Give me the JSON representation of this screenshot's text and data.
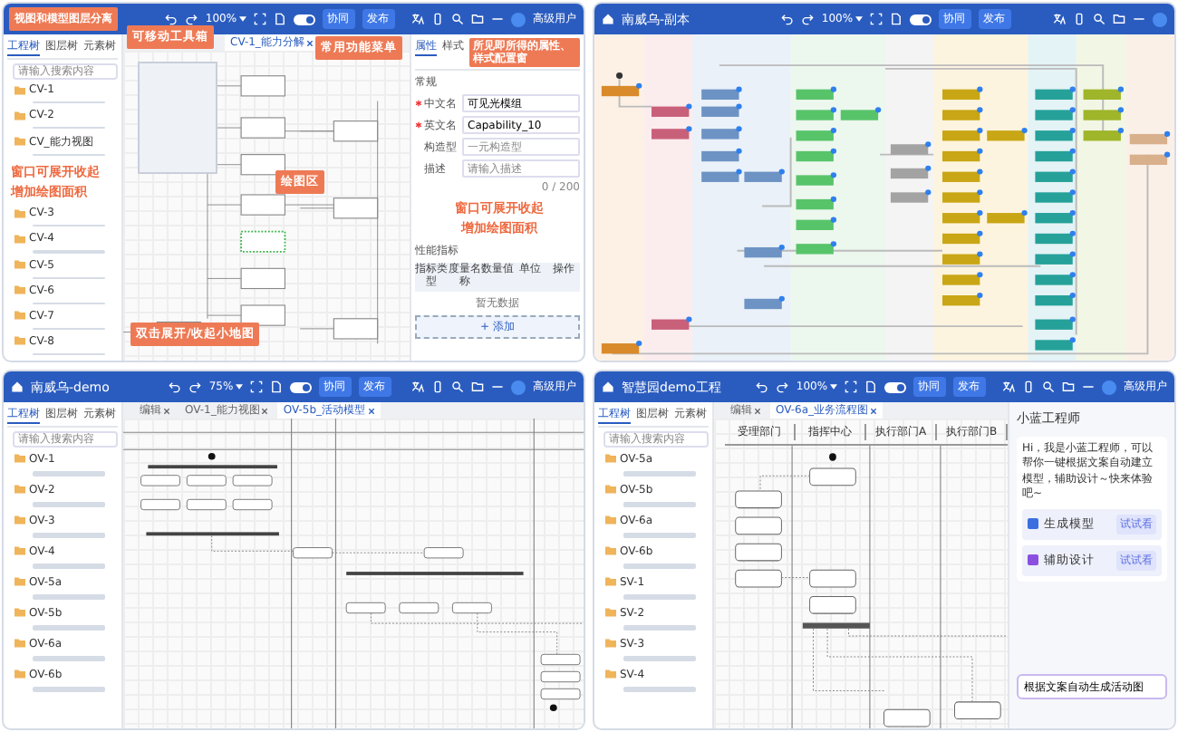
{
  "panels": [
    {
      "zoom": "100%",
      "toggle_on": true,
      "buttons": [
        "协同",
        "发布"
      ],
      "user": "高级用户",
      "sidebar": {
        "tabs": [
          {
            "label": "工程树",
            "selected": true
          },
          {
            "label": "图层树",
            "selected": false
          },
          {
            "label": "元素树",
            "selected": false
          }
        ],
        "placeholder": "请输入搜索内容",
        "tree": [
          {
            "label": "CV-1"
          },
          {
            "label": "CV-2"
          },
          {
            "label": "CV_能力视图"
          },
          {
            "label": "CV-3"
          },
          {
            "label": "CV-4"
          },
          {
            "label": "CV-5"
          },
          {
            "label": "CV-6"
          },
          {
            "label": "CV-7"
          },
          {
            "label": "CV-8"
          }
        ]
      },
      "doc_tabs": [
        {
          "label": "CV-1_能力分解",
          "selected": true
        }
      ],
      "diagram": {
        "kind": "block"
      },
      "properties": {
        "tabs": [
          {
            "label": "属性",
            "selected": true
          },
          {
            "label": "样式",
            "selected": false
          }
        ],
        "section": "常规",
        "fields": [
          {
            "label": "中文名",
            "value": "可见光模组",
            "required": true
          },
          {
            "label": "英文名",
            "value": "Capability_10",
            "required": true
          },
          {
            "label": "构造型",
            "placeholder": "一元构造型",
            "required": false
          },
          {
            "label": "描述",
            "placeholder": "请输入描述",
            "required": false
          }
        ],
        "counter": "0 / 200",
        "table_title": "性能指标",
        "columns": [
          "指标类型",
          "度量名称",
          "数量值",
          "单位",
          "操作"
        ],
        "empty": "暂无数据",
        "add": "+ 添加"
      },
      "callouts": [
        "视图和模型图层分离",
        "可移动工具箱",
        "常用功能菜单",
        "所见即所得的属性、样式配置窗",
        "窗口可展开收起",
        "增加绘图面积",
        "绘图区",
        "窗口可展开收起",
        "增加绘图面积",
        "双击展开/收起小地图"
      ]
    },
    {
      "title": "南威乌-副本",
      "zoom": "100%",
      "toggle_on": true,
      "buttons": [
        "协同",
        "发布"
      ],
      "diagram": {
        "kind": "flow"
      }
    },
    {
      "title": "南威乌-demo",
      "zoom": "75%",
      "toggle_on": true,
      "buttons": [
        "协同",
        "发布"
      ],
      "user": "高级用户",
      "sidebar": {
        "tabs": [
          {
            "label": "工程树",
            "selected": true
          },
          {
            "label": "图层树",
            "selected": false
          },
          {
            "label": "元素树",
            "selected": false
          }
        ],
        "placeholder": "请输入搜索内容",
        "tree": [
          {
            "label": "OV-1"
          },
          {
            "label": "OV-2"
          },
          {
            "label": "OV-3"
          },
          {
            "label": "OV-4"
          },
          {
            "label": "OV-5a"
          },
          {
            "label": "OV-5b"
          },
          {
            "label": "OV-6a"
          },
          {
            "label": "OV-6b"
          }
        ]
      },
      "doc_tabs": [
        {
          "label": "编辑",
          "selected": false
        },
        {
          "label": "OV-1_能力视图",
          "selected": false
        },
        {
          "label": "OV-5b_活动模型",
          "selected": true
        }
      ],
      "diagram": {
        "kind": "activity"
      }
    },
    {
      "title": "智慧园demo工程",
      "zoom": "100%",
      "toggle_on": true,
      "buttons": [
        "协同",
        "发布"
      ],
      "user": "高级用户",
      "sidebar": {
        "tabs": [
          {
            "label": "工程树",
            "selected": true
          },
          {
            "label": "图层树",
            "selected": false
          },
          {
            "label": "元素树",
            "selected": false
          }
        ],
        "placeholder": "请输入搜索内容",
        "tree": [
          {
            "label": "OV-5a"
          },
          {
            "label": "OV-5b"
          },
          {
            "label": "OV-6a"
          },
          {
            "label": "OV-6b"
          },
          {
            "label": "SV-1"
          },
          {
            "label": "SV-2"
          },
          {
            "label": "SV-3"
          },
          {
            "label": "SV-4"
          }
        ]
      },
      "doc_tabs": [
        {
          "label": "编辑",
          "selected": false
        },
        {
          "label": "OV-6a_业务流程图",
          "selected": true
        }
      ],
      "diagram": {
        "kind": "lanes",
        "lanes": [
          "受理部门",
          "指挥中心",
          "执行部门A",
          "执行部门B"
        ]
      },
      "assistant": {
        "title": "小蓝工程师",
        "message": "Hi，我是小蓝工程师，可以帮你一键根据文案自动建立模型，辅助设计～快来体验吧~",
        "actions": [
          {
            "label": "生成模型",
            "button": "试试看",
            "color": "#3b6fe0"
          },
          {
            "label": "辅助设计",
            "button": "试试看",
            "color": "#8b4fe0"
          }
        ],
        "input": "根据文案自动生成活动图"
      }
    }
  ]
}
